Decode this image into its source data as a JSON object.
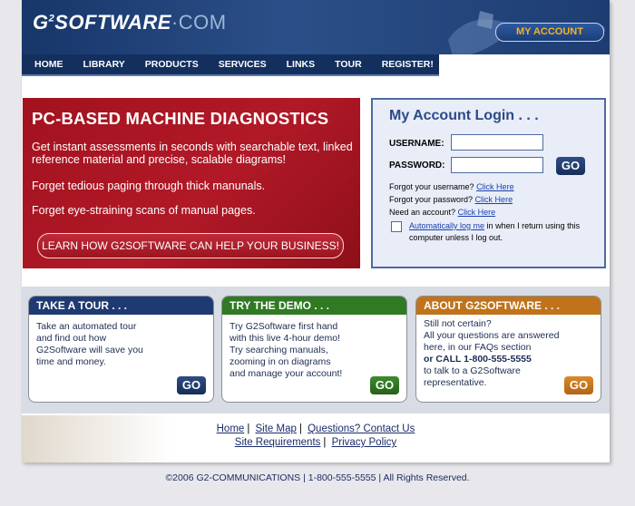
{
  "header": {
    "logo_g2": "G",
    "logo_sup": "2",
    "logo_main": "SOFTWARE",
    "logo_com": "·COM",
    "my_account": "MY ACCOUNT"
  },
  "nav": [
    "HOME",
    "LIBRARY",
    "PRODUCTS",
    "SERVICES",
    "LINKS",
    "TOUR",
    "REGISTER!"
  ],
  "hero": {
    "title": "PC-BASED MACHINE DIAGNOSTICS",
    "p1": "Get instant assessments in seconds with searchable text, linked reference material and precise, scalable diagrams!",
    "p2": "Forget tedious paging through thick manunals.",
    "p3": "Forget eye-straining scans of manual pages.",
    "cta": "LEARN HOW G2SOFTWARE CAN HELP YOUR BUSINESS!"
  },
  "login": {
    "title": "My Account Login . . .",
    "username_label": "USERNAME:",
    "password_label": "PASSWORD:",
    "go": "GO",
    "forgot_user": "Forgot your username?",
    "forgot_pass": "Forgot your password?",
    "need_account": "Need an account?",
    "click_here": "Click Here",
    "remember_link": "Automatically log me",
    "remember_rest": "in when I return using this computer unless I log out."
  },
  "cards": [
    {
      "title": "TAKE A TOUR . . .",
      "lines": [
        "Take an automated tour",
        "and find out how",
        "G2Software will save you",
        "time and money."
      ],
      "go": "GO"
    },
    {
      "title": "TRY THE DEMO . . .",
      "lines": [
        "Try G2Software first hand",
        "with this live 4-hour demo!",
        "Try searching manuals,",
        "zooming in on diagrams",
        "and manage your account!"
      ],
      "go": "GO"
    },
    {
      "title": "ABOUT G2SOFTWARE . . .",
      "lines": [
        "Still not certain?",
        "All your questions are answered",
        "here, in our FAQs section",
        "or CALL 1-800-555-5555",
        "to talk to a G2Software",
        "representative."
      ],
      "go": "GO"
    }
  ],
  "colors": {
    "tour": "#1f3a72",
    "demo": "#2f7a22",
    "about": "#c0731a"
  },
  "footer": {
    "home": "Home",
    "sitemap": "Site Map",
    "questions": "Questions? Contact Us",
    "requirements": "Site Requirements",
    "privacy": "Privacy Policy",
    "copyright": "©2006 G2-COMMUNICATIONS | 1-800-555-5555 | All Rights Reserved."
  }
}
